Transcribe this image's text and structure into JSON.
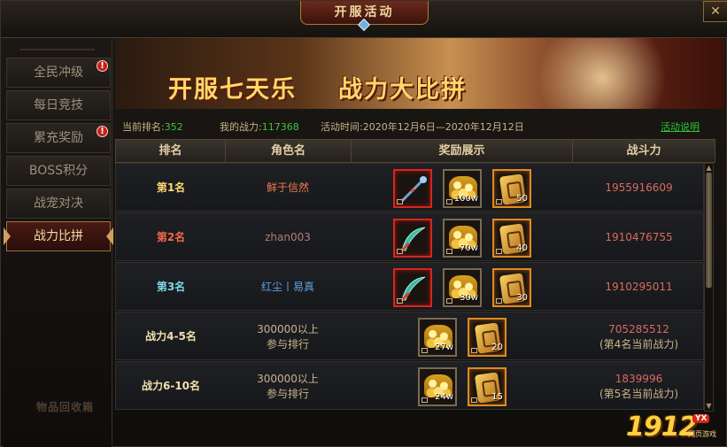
{
  "window": {
    "title": "开服活动",
    "close_icon": "close-icon"
  },
  "sidebar": {
    "items": [
      {
        "label": "全民冲级",
        "alert": true,
        "active": false
      },
      {
        "label": "每日竞技",
        "alert": false,
        "active": false
      },
      {
        "label": "累充奖励",
        "alert": true,
        "active": false
      },
      {
        "label": "BOSS积分",
        "alert": false,
        "active": false
      },
      {
        "label": "战宠对决",
        "alert": false,
        "active": false
      },
      {
        "label": "战力比拼",
        "alert": false,
        "active": true
      }
    ],
    "alert_glyph": "!",
    "watermark": "物品回收箱"
  },
  "banner": {
    "left_text": "开服七天乐",
    "right_text": "战力大比拼"
  },
  "info": {
    "rank_label": "当前排名:",
    "rank_value": "352",
    "power_label": "我的战力:",
    "power_value": "117368",
    "time_label": "活动时间:",
    "time_value": "2020年12月6日—2020年12月12日",
    "rules_link": "活动说明"
  },
  "table": {
    "headers": [
      "排名",
      "角色名",
      "奖励展示",
      "战斗力"
    ],
    "rows": [
      {
        "rank": "第1名",
        "rank_style": "rank-1",
        "name": "鲜于信然",
        "name_style": "name-1",
        "rewards": [
          {
            "icon": "staff-weapon-icon",
            "border": "red",
            "qty": ""
          },
          {
            "icon": "gold-coins-icon",
            "border": "normal",
            "qty": "100w"
          },
          {
            "icon": "gold-token-icon",
            "border": "orange",
            "qty": "50"
          }
        ],
        "power": "1955916609",
        "power_sub": ""
      },
      {
        "rank": "第2名",
        "rank_style": "rank-2",
        "name": "zhan003",
        "name_style": "name-2",
        "rewards": [
          {
            "icon": "crescent-blade-icon",
            "border": "red",
            "qty": ""
          },
          {
            "icon": "gold-coins-icon",
            "border": "normal",
            "qty": "70w"
          },
          {
            "icon": "gold-token-icon",
            "border": "orange",
            "qty": "40"
          }
        ],
        "power": "1910476755",
        "power_sub": ""
      },
      {
        "rank": "第3名",
        "rank_style": "rank-3",
        "name": "红尘丨易真",
        "name_style": "name-3",
        "rewards": [
          {
            "icon": "crescent-blade-icon",
            "border": "red",
            "qty": ""
          },
          {
            "icon": "gold-coins-icon",
            "border": "normal",
            "qty": "30w"
          },
          {
            "icon": "gold-token-icon",
            "border": "orange",
            "qty": "30"
          }
        ],
        "power": "1910295011",
        "power_sub": ""
      },
      {
        "rank": "战力4-5名",
        "rank_style": "rank-n",
        "name": "300000以上",
        "name_sub": "参与排行",
        "name_style": "name-n",
        "rewards": [
          {
            "icon": "gold-coins-icon",
            "border": "normal",
            "qty": "27w"
          },
          {
            "icon": "gold-token-icon",
            "border": "orange",
            "qty": "20"
          }
        ],
        "power": "705285512",
        "power_sub": "(第4名当前战力)"
      },
      {
        "rank": "战力6-10名",
        "rank_style": "rank-n",
        "name": "300000以上",
        "name_sub": "参与排行",
        "name_style": "name-n",
        "rewards": [
          {
            "icon": "gold-coins-icon",
            "border": "normal",
            "qty": "24w"
          },
          {
            "icon": "gold-token-icon",
            "border": "orange",
            "qty": "15"
          }
        ],
        "power": "1839996",
        "power_sub": "(第5名当前战力)"
      }
    ]
  },
  "logo": {
    "main": "1912",
    "badge": "YX",
    "sub": "网页游戏"
  },
  "colors": {
    "accent_gold": "#ffd870",
    "power_red": "#d96a5e",
    "link_green": "#2ec43a",
    "alert_red": "#c8201a"
  }
}
